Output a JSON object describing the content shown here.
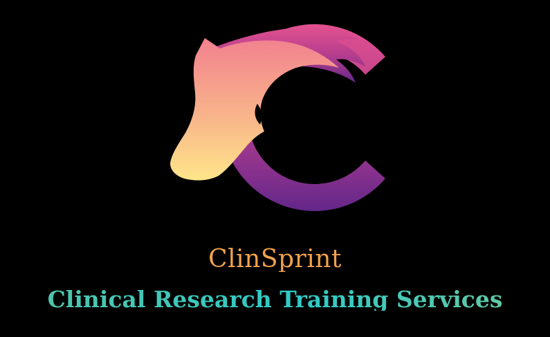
{
  "brand": {
    "name": "ClinSprint",
    "tagline": "Clinical Research Training Services"
  },
  "colors": {
    "background": "#000000",
    "horse_top": "#f28a8f",
    "horse_bottom": "#ffe08a",
    "c_top": "#d94a8f",
    "c_bottom": "#6a2a8a",
    "brand_name": "#f2a24d",
    "tagline": "#3fc7b5"
  },
  "logo": {
    "icon": "horse-head-c-logo-icon"
  }
}
